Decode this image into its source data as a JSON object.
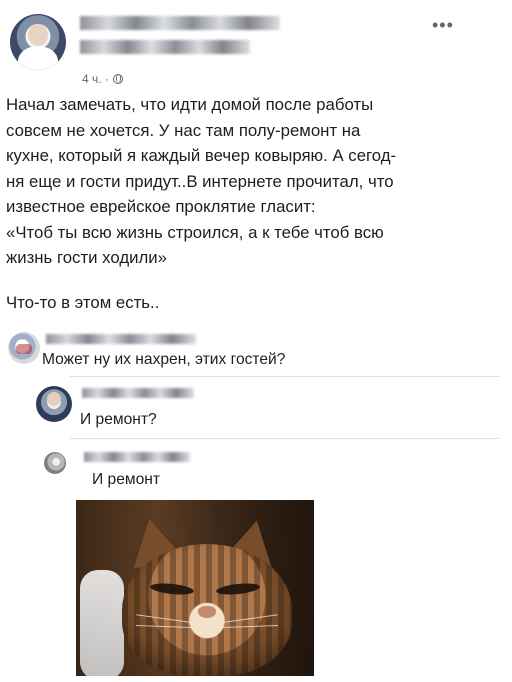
{
  "post": {
    "meta_time": "4 ч. ·",
    "more_icon": "more-horizontal-icon",
    "privacy_icon": "globe-icon",
    "text": "Начал замечать, что идти домой после работы\nсовсем не хочется. У нас там полу-ремонт на\nкухне, который я каждый вечер ковыряю. А сегод-\nня еще и гости придут..В интернете прочитал, что\nизвестное еврейское проклятие гласит:\n«Чтоб ты всю жизнь строился, а к тебе чтоб всю\nжизнь гости ходили»",
    "footer_text": "Что-то в этом есть.."
  },
  "comments": [
    {
      "text": "Может ну их нахрен, этих гостей?"
    },
    {
      "text": "И ремонт?"
    },
    {
      "text": "И ремонт"
    }
  ]
}
